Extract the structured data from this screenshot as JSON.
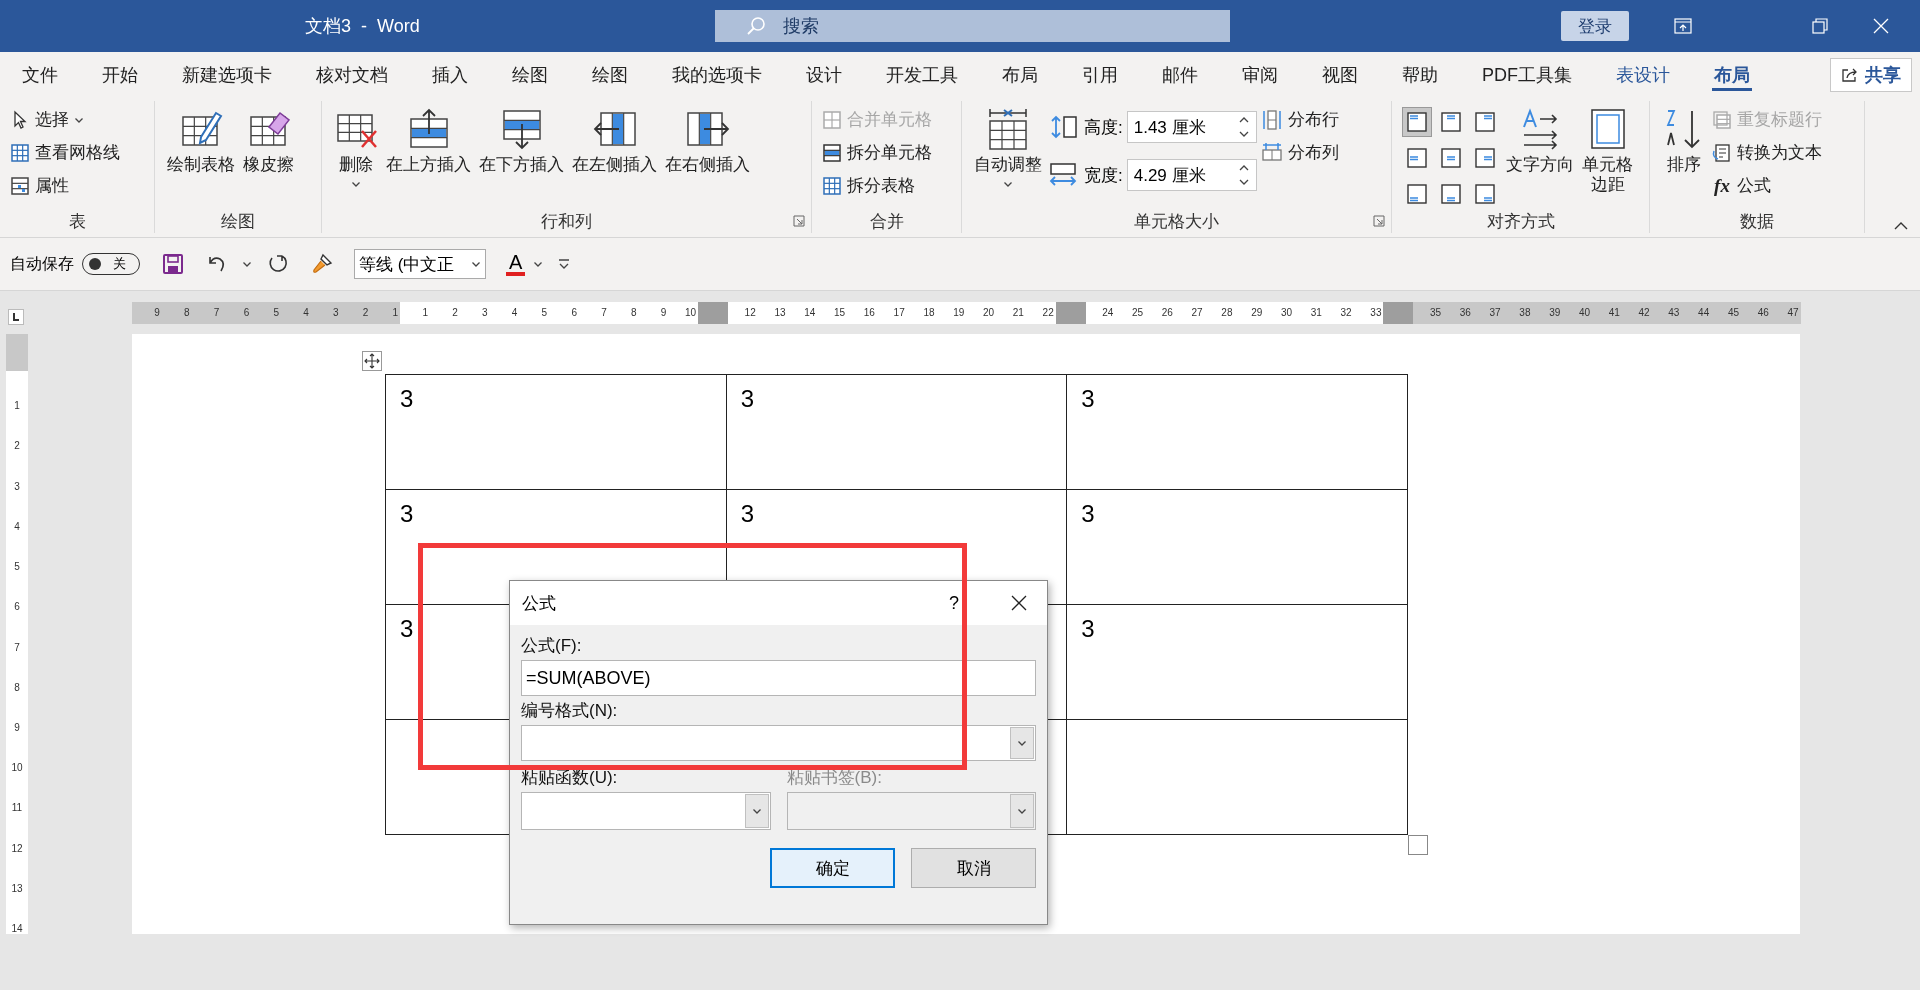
{
  "title_bar": {
    "title": "文档3  -  Word",
    "search_placeholder": "搜索",
    "sign_in": "登录"
  },
  "tabs": [
    {
      "label": "文件",
      "selected": false,
      "contextual": false
    },
    {
      "label": "开始",
      "selected": false,
      "contextual": false
    },
    {
      "label": "新建选项卡",
      "selected": false,
      "contextual": false
    },
    {
      "label": "核对文档",
      "selected": false,
      "contextual": false
    },
    {
      "label": "插入",
      "selected": false,
      "contextual": false
    },
    {
      "label": "绘图",
      "selected": false,
      "contextual": false
    },
    {
      "label": "绘图",
      "selected": false,
      "contextual": false
    },
    {
      "label": "我的选项卡",
      "selected": false,
      "contextual": false
    },
    {
      "label": "设计",
      "selected": false,
      "contextual": false
    },
    {
      "label": "开发工具",
      "selected": false,
      "contextual": false
    },
    {
      "label": "布局",
      "selected": false,
      "contextual": false
    },
    {
      "label": "引用",
      "selected": false,
      "contextual": false
    },
    {
      "label": "邮件",
      "selected": false,
      "contextual": false
    },
    {
      "label": "审阅",
      "selected": false,
      "contextual": false
    },
    {
      "label": "视图",
      "selected": false,
      "contextual": false
    },
    {
      "label": "帮助",
      "selected": false,
      "contextual": false
    },
    {
      "label": "PDF工具集",
      "selected": false,
      "contextual": false
    },
    {
      "label": "表设计",
      "selected": false,
      "contextual": true
    },
    {
      "label": "布局",
      "selected": true,
      "contextual": true
    }
  ],
  "share_button": "共享",
  "ribbon": {
    "groups": [
      {
        "label": "表",
        "launcher": false,
        "items": [
          {
            "kind": "small",
            "label": "选择",
            "dropdown": true,
            "disabled": false
          },
          {
            "kind": "small",
            "label": "查看网格线",
            "dropdown": false,
            "disabled": false
          },
          {
            "kind": "small",
            "label": "属性",
            "dropdown": false,
            "disabled": false
          }
        ]
      },
      {
        "label": "绘图",
        "launcher": false,
        "items": [
          {
            "kind": "large",
            "label": "绘制表格",
            "dropdown": false
          },
          {
            "kind": "large",
            "label": "橡皮擦",
            "dropdown": false
          }
        ]
      },
      {
        "label": "行和列",
        "launcher": true,
        "items": [
          {
            "kind": "large",
            "label": "删除",
            "dropdown": true
          },
          {
            "kind": "large",
            "label": "在上方插入",
            "dropdown": false
          },
          {
            "kind": "large",
            "label": "在下方插入",
            "dropdown": false
          },
          {
            "kind": "large",
            "label": "在左侧插入",
            "dropdown": false
          },
          {
            "kind": "large",
            "label": "在右侧插入",
            "dropdown": false
          }
        ]
      },
      {
        "label": "合并",
        "launcher": false,
        "items": [
          {
            "kind": "small",
            "label": "合并单元格",
            "dropdown": false,
            "disabled": true
          },
          {
            "kind": "small",
            "label": "拆分单元格",
            "dropdown": false,
            "disabled": false
          },
          {
            "kind": "small",
            "label": "拆分表格",
            "dropdown": false,
            "disabled": false
          }
        ]
      },
      {
        "label": "单元格大小",
        "launcher": true,
        "items": [
          {
            "kind": "large",
            "label": "自动调整",
            "dropdown": true
          },
          {
            "kind": "spinner",
            "label": "高度:",
            "value": "1.43 厘米"
          },
          {
            "kind": "spinner",
            "label": "宽度:",
            "value": "4.29 厘米"
          },
          {
            "kind": "small",
            "label": "分布行",
            "dropdown": false,
            "disabled": false
          },
          {
            "kind": "small",
            "label": "分布列",
            "dropdown": false,
            "disabled": false
          }
        ]
      },
      {
        "label": "对齐方式",
        "launcher": false,
        "items": [
          {
            "kind": "align_grid",
            "cells": [
              {
                "selected": true
              },
              {
                "selected": false
              },
              {
                "selected": false
              },
              {
                "selected": false
              },
              {
                "selected": false
              },
              {
                "selected": false
              },
              {
                "selected": false
              },
              {
                "selected": false
              },
              {
                "selected": false
              }
            ]
          },
          {
            "kind": "large",
            "label": "文字方向",
            "dropdown": false
          },
          {
            "kind": "large",
            "lines": [
              "单元格",
              "边距"
            ],
            "dropdown": false
          }
        ]
      },
      {
        "label": "数据",
        "launcher": false,
        "items": [
          {
            "kind": "large",
            "label": "排序",
            "dropdown": false
          },
          {
            "kind": "small",
            "label": "重复标题行",
            "dropdown": false,
            "disabled": true
          },
          {
            "kind": "small",
            "label": "转换为文本",
            "dropdown": false,
            "disabled": false
          },
          {
            "kind": "small",
            "label": "公式",
            "icon_text": "fx",
            "dropdown": false,
            "disabled": false
          }
        ]
      }
    ]
  },
  "quick_access": {
    "autosave_label": "自动保存",
    "autosave": {
      "on": false,
      "label": "关"
    },
    "font": "等线 (中文正",
    "font_color_letter": "A"
  },
  "h_ruler": [
    {
      "kind": "margin",
      "labels": [
        "9",
        "8",
        "7",
        "6",
        "5",
        "4",
        "3",
        "2",
        "1"
      ]
    },
    {
      "kind": "text",
      "labels": [
        "1",
        "2",
        "3",
        "4",
        "5",
        "6",
        "7",
        "8",
        "9",
        "10"
      ]
    },
    {
      "kind": "marker"
    },
    {
      "kind": "text",
      "labels": [
        "12",
        "13",
        "14",
        "15",
        "16",
        "17",
        "18",
        "19",
        "20",
        "21",
        "22"
      ]
    },
    {
      "kind": "marker"
    },
    {
      "kind": "text",
      "labels": [
        "24",
        "25",
        "26",
        "27",
        "28",
        "29",
        "30",
        "31",
        "32",
        "33"
      ]
    },
    {
      "kind": "marker"
    },
    {
      "kind": "margin",
      "labels": [
        "35",
        "36",
        "37",
        "38",
        "39",
        "40",
        "41",
        "42",
        "43",
        "44",
        "45",
        "46",
        "47"
      ]
    }
  ],
  "v_ruler": [
    "1",
    "2",
    "3",
    "4",
    "5",
    "6",
    "7",
    "8",
    "9",
    "10",
    "11",
    "12",
    "13",
    "14"
  ],
  "table": {
    "rows": [
      [
        {
          "text": "3"
        },
        {
          "text": "3"
        },
        {
          "text": "3"
        }
      ],
      [
        {
          "text": "3"
        },
        {
          "text": "3"
        },
        {
          "text": "3"
        }
      ],
      [
        {
          "text": "3"
        },
        {},
        {
          "text": "3"
        }
      ],
      [
        {},
        {},
        {}
      ]
    ]
  },
  "dialog": {
    "title": "公式",
    "help": "?",
    "formula": {
      "label": "公式(F):",
      "value": "=SUM(ABOVE)"
    },
    "number_format": {
      "label": "编号格式(N):"
    },
    "paste_function": {
      "label": "粘贴函数(U):",
      "disabled": false
    },
    "paste_bookmark": {
      "label": "粘贴书签(B):",
      "disabled": true
    },
    "buttons": [
      {
        "label": "确定",
        "default": true
      },
      {
        "label": "取消",
        "default": false
      }
    ]
  },
  "annotations": [
    {
      "kind": "frame"
    }
  ]
}
